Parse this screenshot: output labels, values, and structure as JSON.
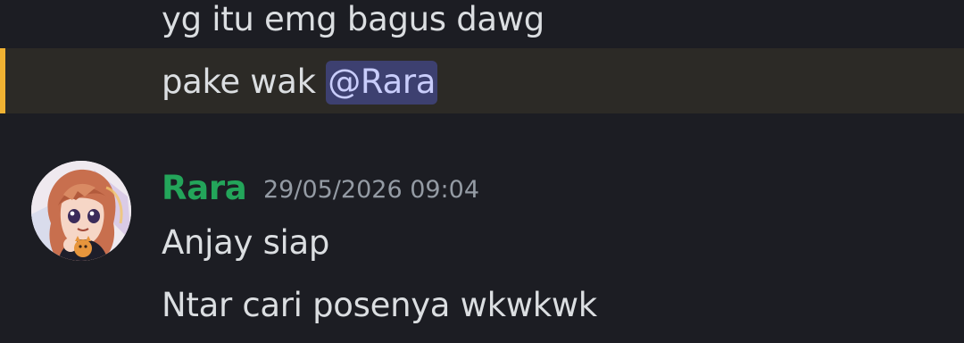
{
  "messages": {
    "prev_1": "yg itu emg bagus dawg",
    "prev_2_text": "pake wak ",
    "prev_2_mention": "@Rara"
  },
  "next_group": {
    "author": "Rara",
    "timestamp": "29/05/2026 09:04",
    "lines": [
      "Anjay siap",
      "Ntar cari posenya wkwkwk"
    ],
    "author_color": "#23a55a"
  },
  "colors": {
    "background": "#1c1d23",
    "mention_highlight_bg": "#2c2a26",
    "mention_bar": "#f0b232",
    "mention_pill_bg": "#3d4070",
    "mention_pill_text": "#c9cdfb",
    "timestamp": "#949ba4"
  }
}
